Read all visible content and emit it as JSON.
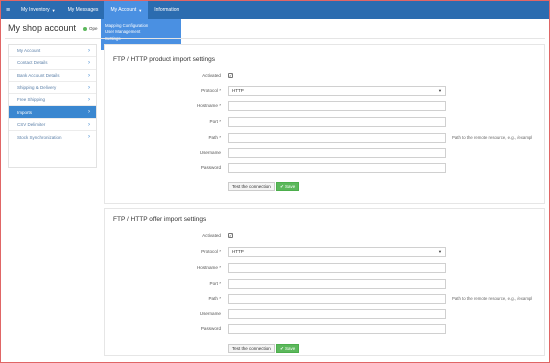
{
  "nav": {
    "menu_icon": "hamburger-icon",
    "items": [
      {
        "label": "My Inventory",
        "caret": "▼"
      },
      {
        "label": "My Messages",
        "caret": ""
      },
      {
        "label": "My Account",
        "caret": "▼"
      },
      {
        "label": "Information",
        "caret": ""
      }
    ],
    "dropdown": [
      "Mapping Configuration",
      "User Management",
      "Settings"
    ],
    "color": "#2b6cb0",
    "active_color": "#4a90e2"
  },
  "header": {
    "title": "My shop account",
    "status": "Ope"
  },
  "sidebar": {
    "items": [
      {
        "label": "My Account"
      },
      {
        "label": "Contact Details"
      },
      {
        "label": "Bank Account Details"
      },
      {
        "label": "Shipping & Delivery"
      },
      {
        "label": "Free Shipping"
      },
      {
        "label": "Imports"
      },
      {
        "label": "CSV Delimiter"
      },
      {
        "label": "Stock Synchronization"
      }
    ],
    "active_index": 5
  },
  "panels": [
    {
      "title": "FTP / HTTP product import settings",
      "fields": {
        "activated_label": "Activated",
        "protocol_label": "Protocol *",
        "protocol_value": "HTTP",
        "hostname_label": "Hostname *",
        "port_label": "Port *",
        "path_label": "Path *",
        "path_hint": "Path to the remote resource, e.g., /exampl",
        "username_label": "Username",
        "password_label": "Password"
      },
      "test_button": "Test the connection",
      "save_button": "Save"
    },
    {
      "title": "FTP / HTTP offer import settings",
      "fields": {
        "activated_label": "Activated",
        "protocol_label": "Protocol *",
        "protocol_value": "HTTP",
        "hostname_label": "Hostname *",
        "port_label": "Port *",
        "path_label": "Path *",
        "path_hint": "Path to the remote resource, e.g., /exampl",
        "username_label": "Username",
        "password_label": "Password"
      },
      "test_button": "Test the connection",
      "save_button": "Save"
    }
  ]
}
